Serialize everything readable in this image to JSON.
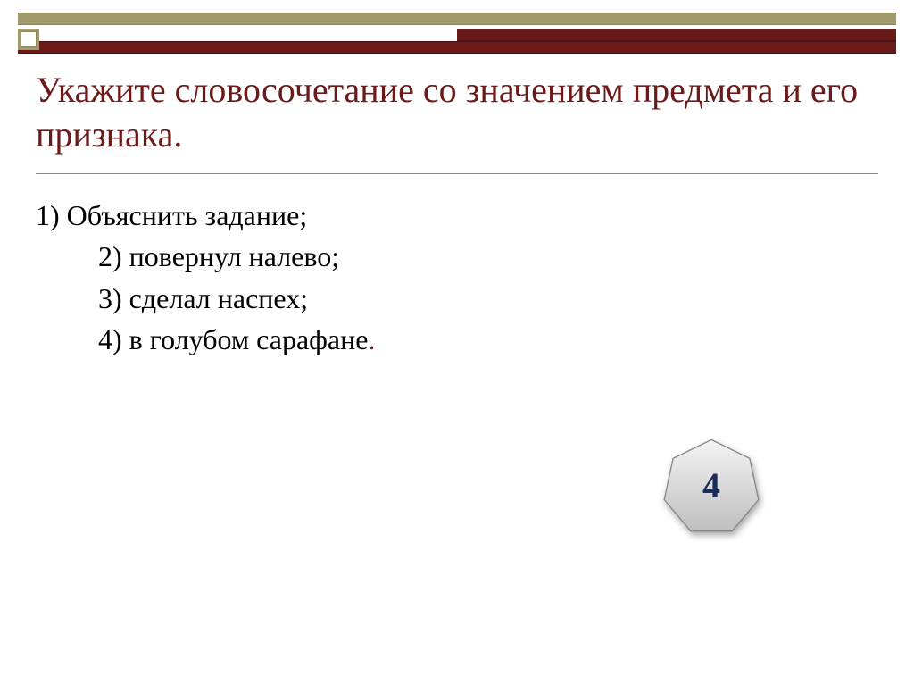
{
  "title": "Укажите словосочетание со значением предмета и его признака.",
  "options": {
    "line1": "1) Объяснить задание;",
    "line2": "2) повернул налево;",
    "line3": "3) сделал наспех;",
    "line4_main": "4) в голубом сарафане",
    "line4_punct": "."
  },
  "answer": "4"
}
